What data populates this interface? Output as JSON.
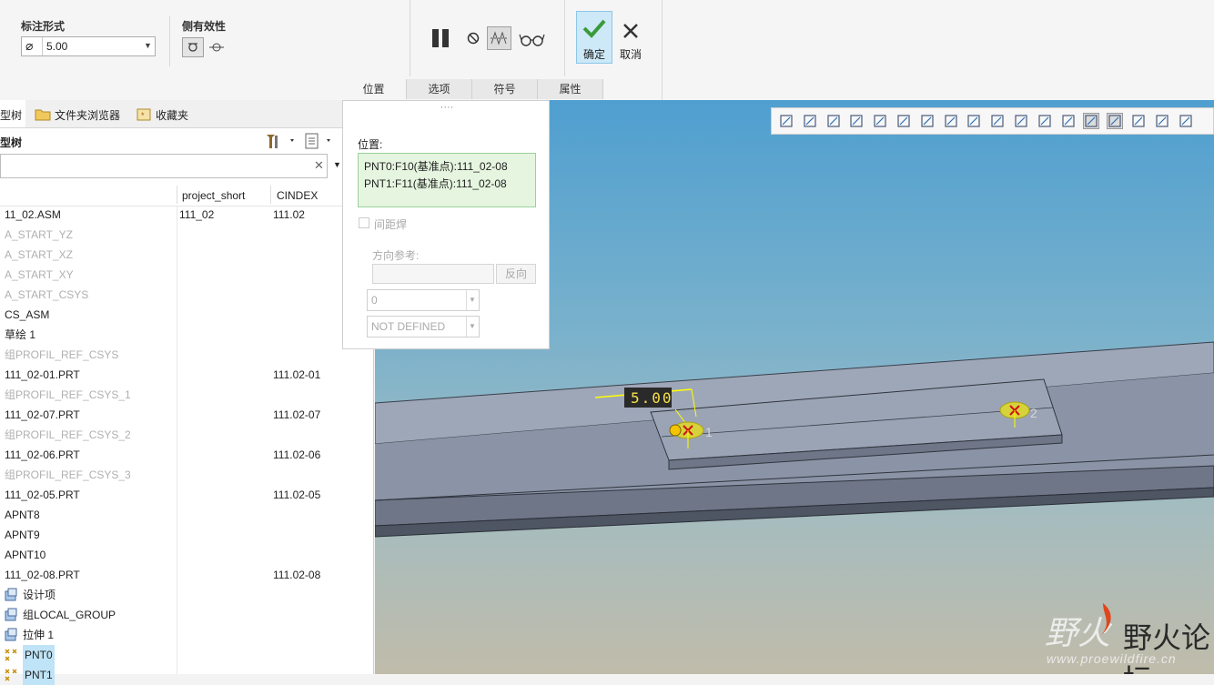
{
  "ribbon": {
    "dim_group_title": "标注形式",
    "dim_value": "5.00",
    "side_group_title": "侧有效性",
    "ok_label": "确定",
    "cancel_label": "取消",
    "tabs": [
      "位置",
      "选项",
      "符号",
      "属性"
    ]
  },
  "left_panel": {
    "tabs": [
      "型树",
      "文件夹浏览器",
      "收藏夹"
    ],
    "section_title": "型树",
    "columns": [
      "project_short",
      "CINDEX"
    ],
    "rows": [
      {
        "name": "11_02.ASM",
        "project_short": "111_02",
        "cindex": "111.02",
        "style": "normal"
      },
      {
        "name": "A_START_YZ",
        "project_short": "",
        "cindex": "",
        "style": "grey"
      },
      {
        "name": "A_START_XZ",
        "project_short": "",
        "cindex": "",
        "style": "grey"
      },
      {
        "name": "A_START_XY",
        "project_short": "",
        "cindex": "",
        "style": "grey"
      },
      {
        "name": "A_START_CSYS",
        "project_short": "",
        "cindex": "",
        "style": "grey"
      },
      {
        "name": "CS_ASM",
        "project_short": "",
        "cindex": "",
        "style": "normal"
      },
      {
        "name": "草绘 1",
        "project_short": "",
        "cindex": "",
        "style": "normal"
      },
      {
        "name": "组PROFIL_REF_CSYS",
        "project_short": "",
        "cindex": "",
        "style": "grey"
      },
      {
        "name": "111_02-01.PRT",
        "project_short": "",
        "cindex": "111.02-01",
        "style": "normal"
      },
      {
        "name": "组PROFIL_REF_CSYS_1",
        "project_short": "",
        "cindex": "",
        "style": "grey"
      },
      {
        "name": "111_02-07.PRT",
        "project_short": "",
        "cindex": "111.02-07",
        "style": "normal"
      },
      {
        "name": "组PROFIL_REF_CSYS_2",
        "project_short": "",
        "cindex": "",
        "style": "grey"
      },
      {
        "name": "111_02-06.PRT",
        "project_short": "",
        "cindex": "111.02-06",
        "style": "normal"
      },
      {
        "name": "组PROFIL_REF_CSYS_3",
        "project_short": "",
        "cindex": "",
        "style": "grey"
      },
      {
        "name": "111_02-05.PRT",
        "project_short": "",
        "cindex": "111.02-05",
        "style": "normal"
      },
      {
        "name": "APNT8",
        "project_short": "",
        "cindex": "",
        "style": "normal"
      },
      {
        "name": "APNT9",
        "project_short": "",
        "cindex": "",
        "style": "normal"
      },
      {
        "name": "APNT10",
        "project_short": "",
        "cindex": "",
        "style": "normal"
      },
      {
        "name": "111_02-08.PRT",
        "project_short": "",
        "cindex": "111.02-08",
        "style": "normal"
      },
      {
        "name": "设计项",
        "project_short": "",
        "cindex": "",
        "style": "icon"
      },
      {
        "name": "组LOCAL_GROUP",
        "project_short": "",
        "cindex": "",
        "style": "icon"
      },
      {
        "name": "拉伸 1",
        "project_short": "",
        "cindex": "",
        "style": "icon"
      },
      {
        "name": "PNT0",
        "project_short": "",
        "cindex": "",
        "style": "selected"
      },
      {
        "name": "PNT1",
        "project_short": "",
        "cindex": "",
        "style": "selected"
      }
    ]
  },
  "popup": {
    "dots": "····",
    "position_label": "位置:",
    "position_items": [
      "PNT0:F10(基准点):111_02-08",
      "PNT1:F11(基准点):111_02-08"
    ],
    "spacing_weld_label": "间距焊",
    "direction_ref_label": "方向参考:",
    "reverse_label": "反向",
    "value_dropdown": "0",
    "type_dropdown": "NOT DEFINED"
  },
  "viewport": {
    "dimension_label": "5.00",
    "point1_label": "1",
    "point2_label": "2",
    "watermark_title": "野火论坛",
    "watermark_url": "www.proewildfire.cn"
  }
}
